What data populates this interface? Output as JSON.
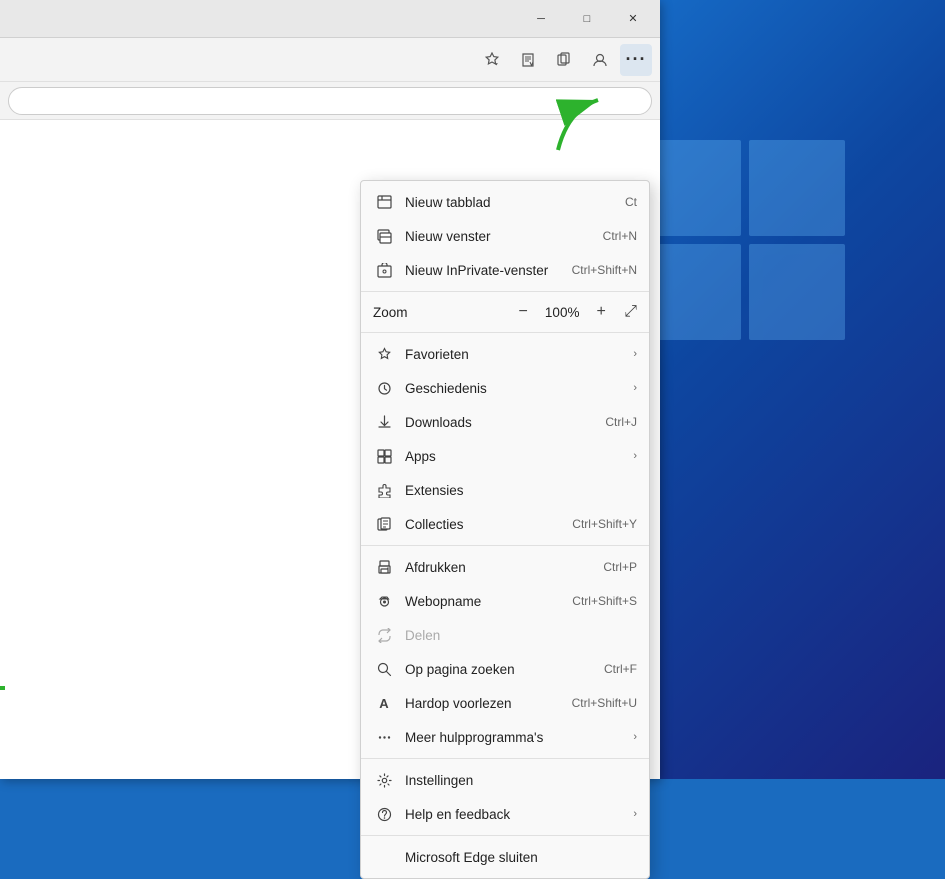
{
  "desktop": {
    "bg_color": "#1565c0"
  },
  "browser": {
    "title_bar": {
      "minimize_label": "─",
      "maximize_label": "□",
      "close_label": "✕"
    },
    "toolbar": {
      "favorites_icon": "☆",
      "collections_icon": "❒",
      "profile_icon": "👤",
      "menu_icon": "···"
    }
  },
  "menu": {
    "items": [
      {
        "id": "new-tab",
        "icon": "⬜",
        "label": "Nieuw tabblad",
        "shortcut": "Ct",
        "has_arrow": false,
        "disabled": false,
        "icon_type": "new-tab"
      },
      {
        "id": "new-window",
        "icon": "⬜",
        "label": "Nieuw venster",
        "shortcut": "Ctrl+N",
        "has_arrow": false,
        "disabled": false,
        "icon_type": "new-window"
      },
      {
        "id": "new-private",
        "icon": "⬜",
        "label": "Nieuw InPrivate-venster",
        "shortcut": "Ctrl+Shift+N",
        "has_arrow": false,
        "disabled": false,
        "icon_type": "inprivate"
      },
      {
        "id": "divider1",
        "type": "divider"
      },
      {
        "id": "zoom",
        "type": "zoom",
        "label": "Zoom",
        "minus": "−",
        "value": "100%",
        "plus": "+",
        "fullscreen": "⤢"
      },
      {
        "id": "divider2",
        "type": "divider"
      },
      {
        "id": "favorites",
        "icon": "☆",
        "label": "Favorieten",
        "shortcut": "",
        "has_arrow": true,
        "disabled": false,
        "icon_type": "favorites"
      },
      {
        "id": "history",
        "icon": "🕐",
        "label": "Geschiedenis",
        "shortcut": "",
        "has_arrow": true,
        "disabled": false,
        "icon_type": "history"
      },
      {
        "id": "downloads",
        "icon": "⬇",
        "label": "Downloads",
        "shortcut": "Ctrl+J",
        "has_arrow": false,
        "disabled": false,
        "icon_type": "downloads"
      },
      {
        "id": "apps",
        "icon": "⊞",
        "label": "Apps",
        "shortcut": "",
        "has_arrow": true,
        "disabled": false,
        "icon_type": "apps"
      },
      {
        "id": "extensions",
        "icon": "🧩",
        "label": "Extensies",
        "shortcut": "",
        "has_arrow": false,
        "disabled": false,
        "icon_type": "extensions"
      },
      {
        "id": "collections",
        "icon": "❒",
        "label": "Collecties",
        "shortcut": "Ctrl+Shift+Y",
        "has_arrow": false,
        "disabled": false,
        "icon_type": "collections"
      },
      {
        "id": "divider3",
        "type": "divider"
      },
      {
        "id": "print",
        "icon": "🖨",
        "label": "Afdrukken",
        "shortcut": "Ctrl+P",
        "has_arrow": false,
        "disabled": false,
        "icon_type": "print"
      },
      {
        "id": "websnap",
        "icon": "📷",
        "label": "Webopname",
        "shortcut": "Ctrl+Shift+S",
        "has_arrow": false,
        "disabled": false,
        "icon_type": "websnap"
      },
      {
        "id": "share",
        "icon": "↗",
        "label": "Delen",
        "shortcut": "",
        "has_arrow": false,
        "disabled": true,
        "icon_type": "share"
      },
      {
        "id": "find",
        "icon": "🔍",
        "label": "Op pagina zoeken",
        "shortcut": "Ctrl+F",
        "has_arrow": false,
        "disabled": false,
        "icon_type": "find"
      },
      {
        "id": "read-aloud",
        "icon": "A",
        "label": "Hardop voorlezen",
        "shortcut": "Ctrl+Shift+U",
        "has_arrow": false,
        "disabled": false,
        "icon_type": "read-aloud"
      },
      {
        "id": "more-tools",
        "icon": "⚙",
        "label": "Meer hulpprogramma's",
        "shortcut": "",
        "has_arrow": true,
        "disabled": false,
        "icon_type": "more-tools"
      },
      {
        "id": "divider4",
        "type": "divider"
      },
      {
        "id": "settings",
        "icon": "⚙",
        "label": "Instellingen",
        "shortcut": "",
        "has_arrow": false,
        "disabled": false,
        "icon_type": "settings"
      },
      {
        "id": "help",
        "icon": "?",
        "label": "Help en feedback",
        "shortcut": "",
        "has_arrow": true,
        "disabled": false,
        "icon_type": "help"
      },
      {
        "id": "divider5",
        "type": "divider"
      },
      {
        "id": "close-edge",
        "label": "Microsoft Edge sluiten",
        "shortcut": "",
        "has_arrow": false,
        "disabled": false,
        "icon_type": "none",
        "no_icon": true
      }
    ],
    "zoom_value": "100%"
  }
}
